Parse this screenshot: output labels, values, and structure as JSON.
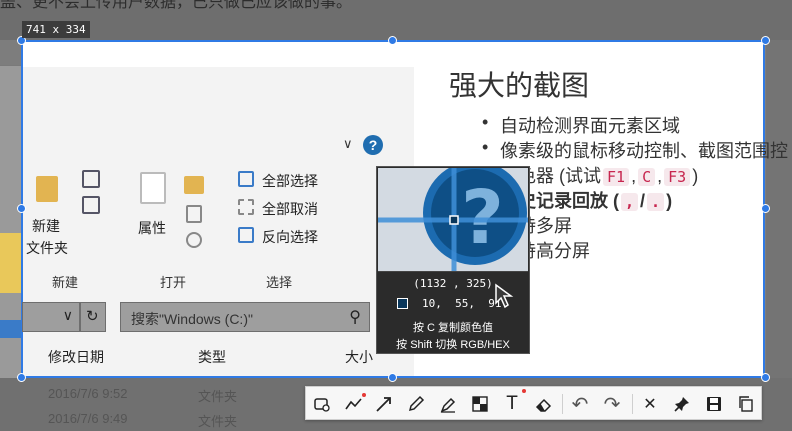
{
  "background": {
    "top_text": "盖、更不会上传用户数据，已只做已应该做的事。"
  },
  "selection": {
    "size_label": "741 x 334"
  },
  "explorer": {
    "minimize": "—",
    "maximize": "☐",
    "close": "✕",
    "ribbon": {
      "new_label": "新建",
      "folder_label": "文件夹",
      "properties_label": "属性",
      "select_all": "全部选择",
      "select_none": "全部取消",
      "invert_selection": "反向选择",
      "group_new": "新建",
      "group_open": "打开",
      "group_select": "选择"
    },
    "search_placeholder": "搜索\"Windows (C:)\"",
    "columns": {
      "modified": "修改日期",
      "type": "类型",
      "size": "大小"
    },
    "rows": [
      {
        "modified": "2016/7/6 9:52",
        "type": "文件夹"
      },
      {
        "modified": "2016/7/6 9:49",
        "type": "文件夹"
      }
    ]
  },
  "features": {
    "title": "强大的截图",
    "item1": "自动检测界面元素区域",
    "item2": "像素级的鼠标移动控制、截图范围控",
    "item3_prefix": "取色器 (试试",
    "item3_k1": "F1",
    "item3_k2": "C",
    "item3_k3": "F3",
    "item3_suffix": ")",
    "item4_prefix": "历史记录回放 (",
    "item4_k1": ",",
    "item4_k2": ".",
    "item4_suffix": ")",
    "item5": "支持多屏",
    "item6": "支持高分屏"
  },
  "magnifier": {
    "coords": "(1132 , 325)",
    "rgb": "10,  55,  91",
    "hint_copy": "按 C 复制颜色值",
    "hint_switch": "按 Shift 切换 RGB/HEX",
    "color": "#0a375b"
  },
  "toolbar": {
    "rect": "rectangle-icon",
    "curve": "curve-icon",
    "arrow": "arrow-icon",
    "pencil": "pencil-icon",
    "marker": "marker-icon",
    "mosaic": "mosaic-icon",
    "text": "T",
    "eraser": "eraser-icon",
    "undo": "↶",
    "redo": "↷",
    "cancel": "✕",
    "pin": "pin-icon",
    "save": "save-icon",
    "copy": "copy-icon",
    "accent": "#2f7ae5"
  }
}
